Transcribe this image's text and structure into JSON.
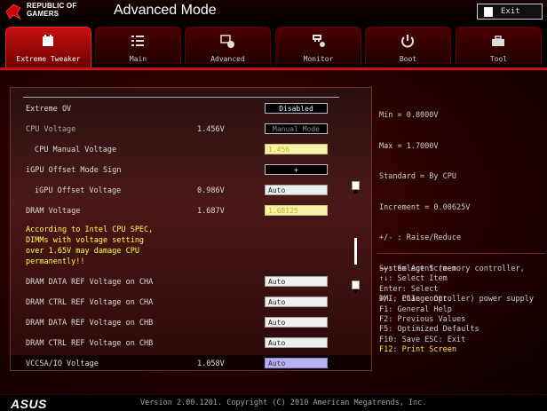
{
  "header": {
    "brand_line1": "REPUBLIC OF",
    "brand_line2": "GAMERS",
    "title": "Advanced Mode",
    "exit_label": "Exit"
  },
  "tabs": [
    {
      "label": "Extreme Tweaker",
      "icon": "tweaker-icon",
      "active": true
    },
    {
      "label": "Main",
      "icon": "list-icon"
    },
    {
      "label": "Advanced",
      "icon": "advanced-icon"
    },
    {
      "label": "Monitor",
      "icon": "monitor-icon"
    },
    {
      "label": "Boot",
      "icon": "power-icon"
    },
    {
      "label": "Tool",
      "icon": "toolbox-icon"
    }
  ],
  "settings": {
    "extreme_ov": {
      "label": "Extreme OV",
      "control": "Disabled"
    },
    "cpu_voltage": {
      "label": "CPU Voltage",
      "value": "1.456V",
      "control": "Manual Mode"
    },
    "cpu_manual_voltage": {
      "label": "CPU Manual Voltage",
      "control": "1.456"
    },
    "igpu_offset_sign": {
      "label": "iGPU Offset Mode Sign",
      "control": "+"
    },
    "igpu_offset_voltage": {
      "label": "iGPU Offset Voltage",
      "value": "0.986V",
      "control": "Auto"
    },
    "dram_voltage": {
      "label": "DRAM Voltage",
      "value": "1.687V",
      "control": "1.68125"
    },
    "warning_lines": [
      "According to Intel CPU SPEC,",
      "DIMMs with voltage setting",
      "over 1.65V may damage CPU",
      "permanently!!"
    ],
    "dram_data_ref_cha": {
      "label": "DRAM DATA REF Voltage on CHA",
      "control": "Auto"
    },
    "dram_ctrl_ref_cha": {
      "label": "DRAM CTRL REF Voltage on CHA",
      "control": "Auto"
    },
    "dram_data_ref_chb": {
      "label": "DRAM DATA REF Voltage on CHB",
      "control": "Auto"
    },
    "dram_ctrl_ref_chb": {
      "label": "DRAM CTRL REF Voltage on CHB",
      "control": "Auto"
    },
    "vccsa_io_voltage": {
      "label": "VCCSA/IO Voltage",
      "value": "1.058V",
      "control": "Auto"
    }
  },
  "help": {
    "lines": [
      "Min = 0.8000V",
      "Max = 1.7000V",
      "Standard = By CPU",
      "Increment = 0.00625V",
      "+/- : Raise/Reduce",
      "System Agent (memory controller,",
      "DMI, PCIe controller) power supply"
    ]
  },
  "keys": {
    "lines": [
      "→←: Select Screen",
      "↑↓: Select Item",
      "Enter: Select",
      "+/-: Change Opt.",
      "F1: General Help",
      "F2: Previous Values",
      "F5: Optimized Defaults",
      "F10: Save  ESC: Exit"
    ],
    "highlight": "F12: Print Screen"
  },
  "footer": {
    "logo": "ASUS",
    "version": "Version 2.00.1201. Copyright (C) 2010 American Megatrends, Inc."
  },
  "colors": {
    "accent": "#d01010",
    "warning": "#ffff44"
  }
}
